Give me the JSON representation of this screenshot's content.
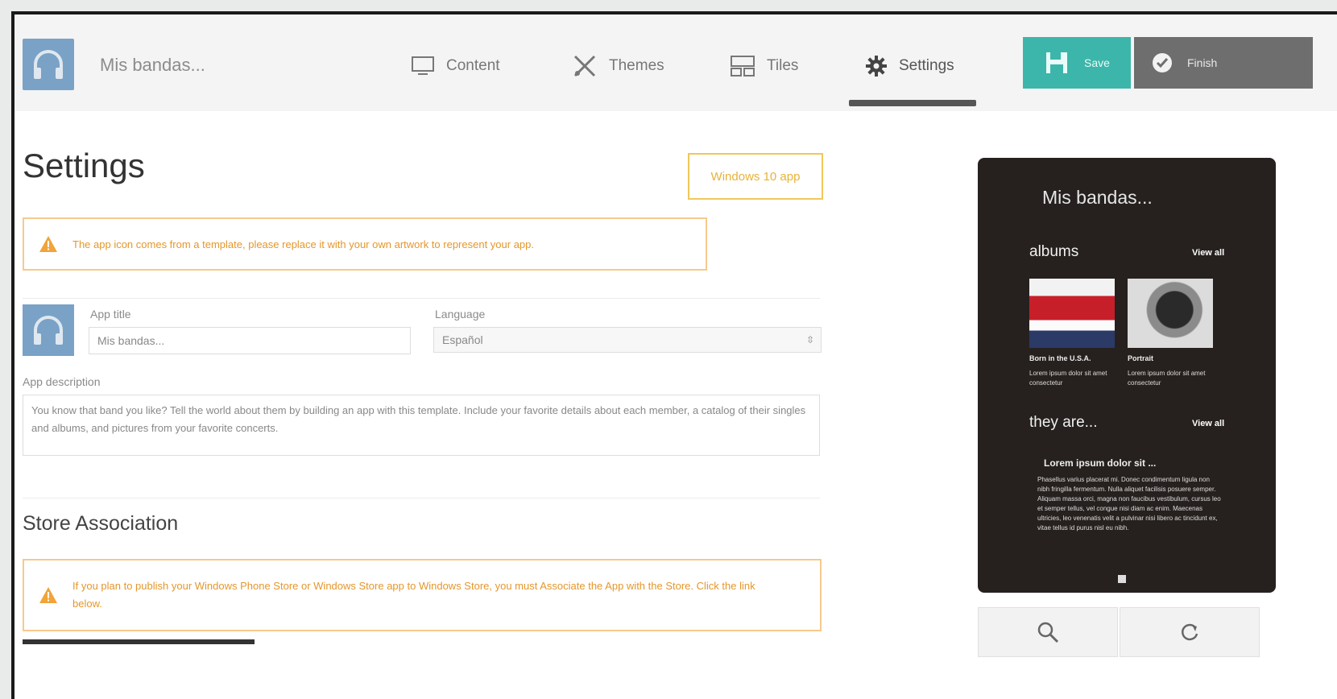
{
  "header": {
    "app_name": "Mis bandas...",
    "nav": [
      {
        "label": "Content",
        "icon": "monitor-icon"
      },
      {
        "label": "Themes",
        "icon": "brush-icon"
      },
      {
        "label": "Tiles",
        "icon": "tiles-icon"
      },
      {
        "label": "Settings",
        "icon": "gear-icon",
        "active": true
      }
    ],
    "save_label": "Save",
    "finish_label": "Finish"
  },
  "main": {
    "title": "Settings",
    "platform_badge": "Windows 10 app",
    "icon_warning": "The app icon comes from a template, please replace it with your own artwork to represent your app.",
    "app_title_label": "App title",
    "app_title_value": "Mis bandas...",
    "language_label": "Language",
    "language_value": "Español",
    "description_label": "App description",
    "description_value": "You know that band you like? Tell the world about them by building an app with this template. Include your favorite details about each member, a catalog of their singles and albums, and pictures from your favorite concerts.",
    "store_title": "Store Association",
    "store_warning": "If you plan to publish your Windows Phone Store or Windows Store app to Windows Store, you must Associate the App with the Store. Click the link below."
  },
  "preview": {
    "title": "Mis bandas...",
    "section1": "albums",
    "section2": "they are...",
    "view_all": "View all",
    "album1": "Born in the U.S.A.",
    "album2": "Portrait",
    "album_text": "Lorem ipsum dolor sit amet consectetur",
    "para_title": "Lorem ipsum dolor sit ...",
    "para": "Phasellus varius placerat mi. Donec condimentum ligula non nibh fringilla fermentum. Nulla aliquet facilisis posuere semper. Aliquam massa orci, magna non faucibus vestibulum, cursus leo et semper tellus, vel congue nisi diam ac enim. Maecenas ultricies, leo venenatis velit a pulvinar nisi libero ac tincidunt ex, vitae tellus id purus nisl eu nibh."
  },
  "colors": {
    "save": "#3cb6aa",
    "finish": "#6e6e6e",
    "warning_border": "#f7c98d",
    "warning_text": "#e4972c",
    "phone_bg": "#26211f"
  }
}
